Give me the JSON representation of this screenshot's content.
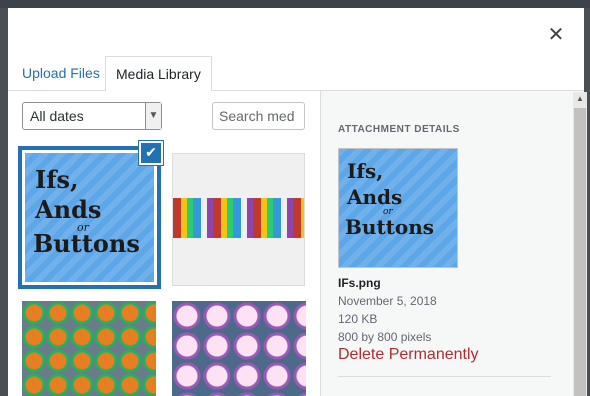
{
  "modal": {
    "close_icon": "close-icon"
  },
  "tabs": [
    {
      "label": "Upload Files"
    },
    {
      "label": "Media Library"
    }
  ],
  "toolbar": {
    "date_filter": "All dates",
    "search_placeholder": "Search med"
  },
  "grid": {
    "items": [
      {
        "alt": "IFs.png",
        "selected": true,
        "logo_line1": "Ifs,",
        "logo_line2": "Ands",
        "logo_line3": "or",
        "logo_line4": "Buttons"
      },
      {
        "alt": "buttons banner"
      },
      {
        "alt": "pride buttons"
      },
      {
        "alt": "unicorn buttons"
      }
    ]
  },
  "details": {
    "heading": "ATTACHMENT DETAILS",
    "logo_line1": "Ifs,",
    "logo_line2": "Ands",
    "logo_line3": "or",
    "logo_line4": "Buttons",
    "filename": "IFs.png",
    "date": "November 5, 2018",
    "size": "120 KB",
    "dimensions": "800 by 800 pixels",
    "delete_label": "Delete Permanently"
  },
  "colors": {
    "accent": "#2271b1",
    "danger": "#b32d2e"
  }
}
